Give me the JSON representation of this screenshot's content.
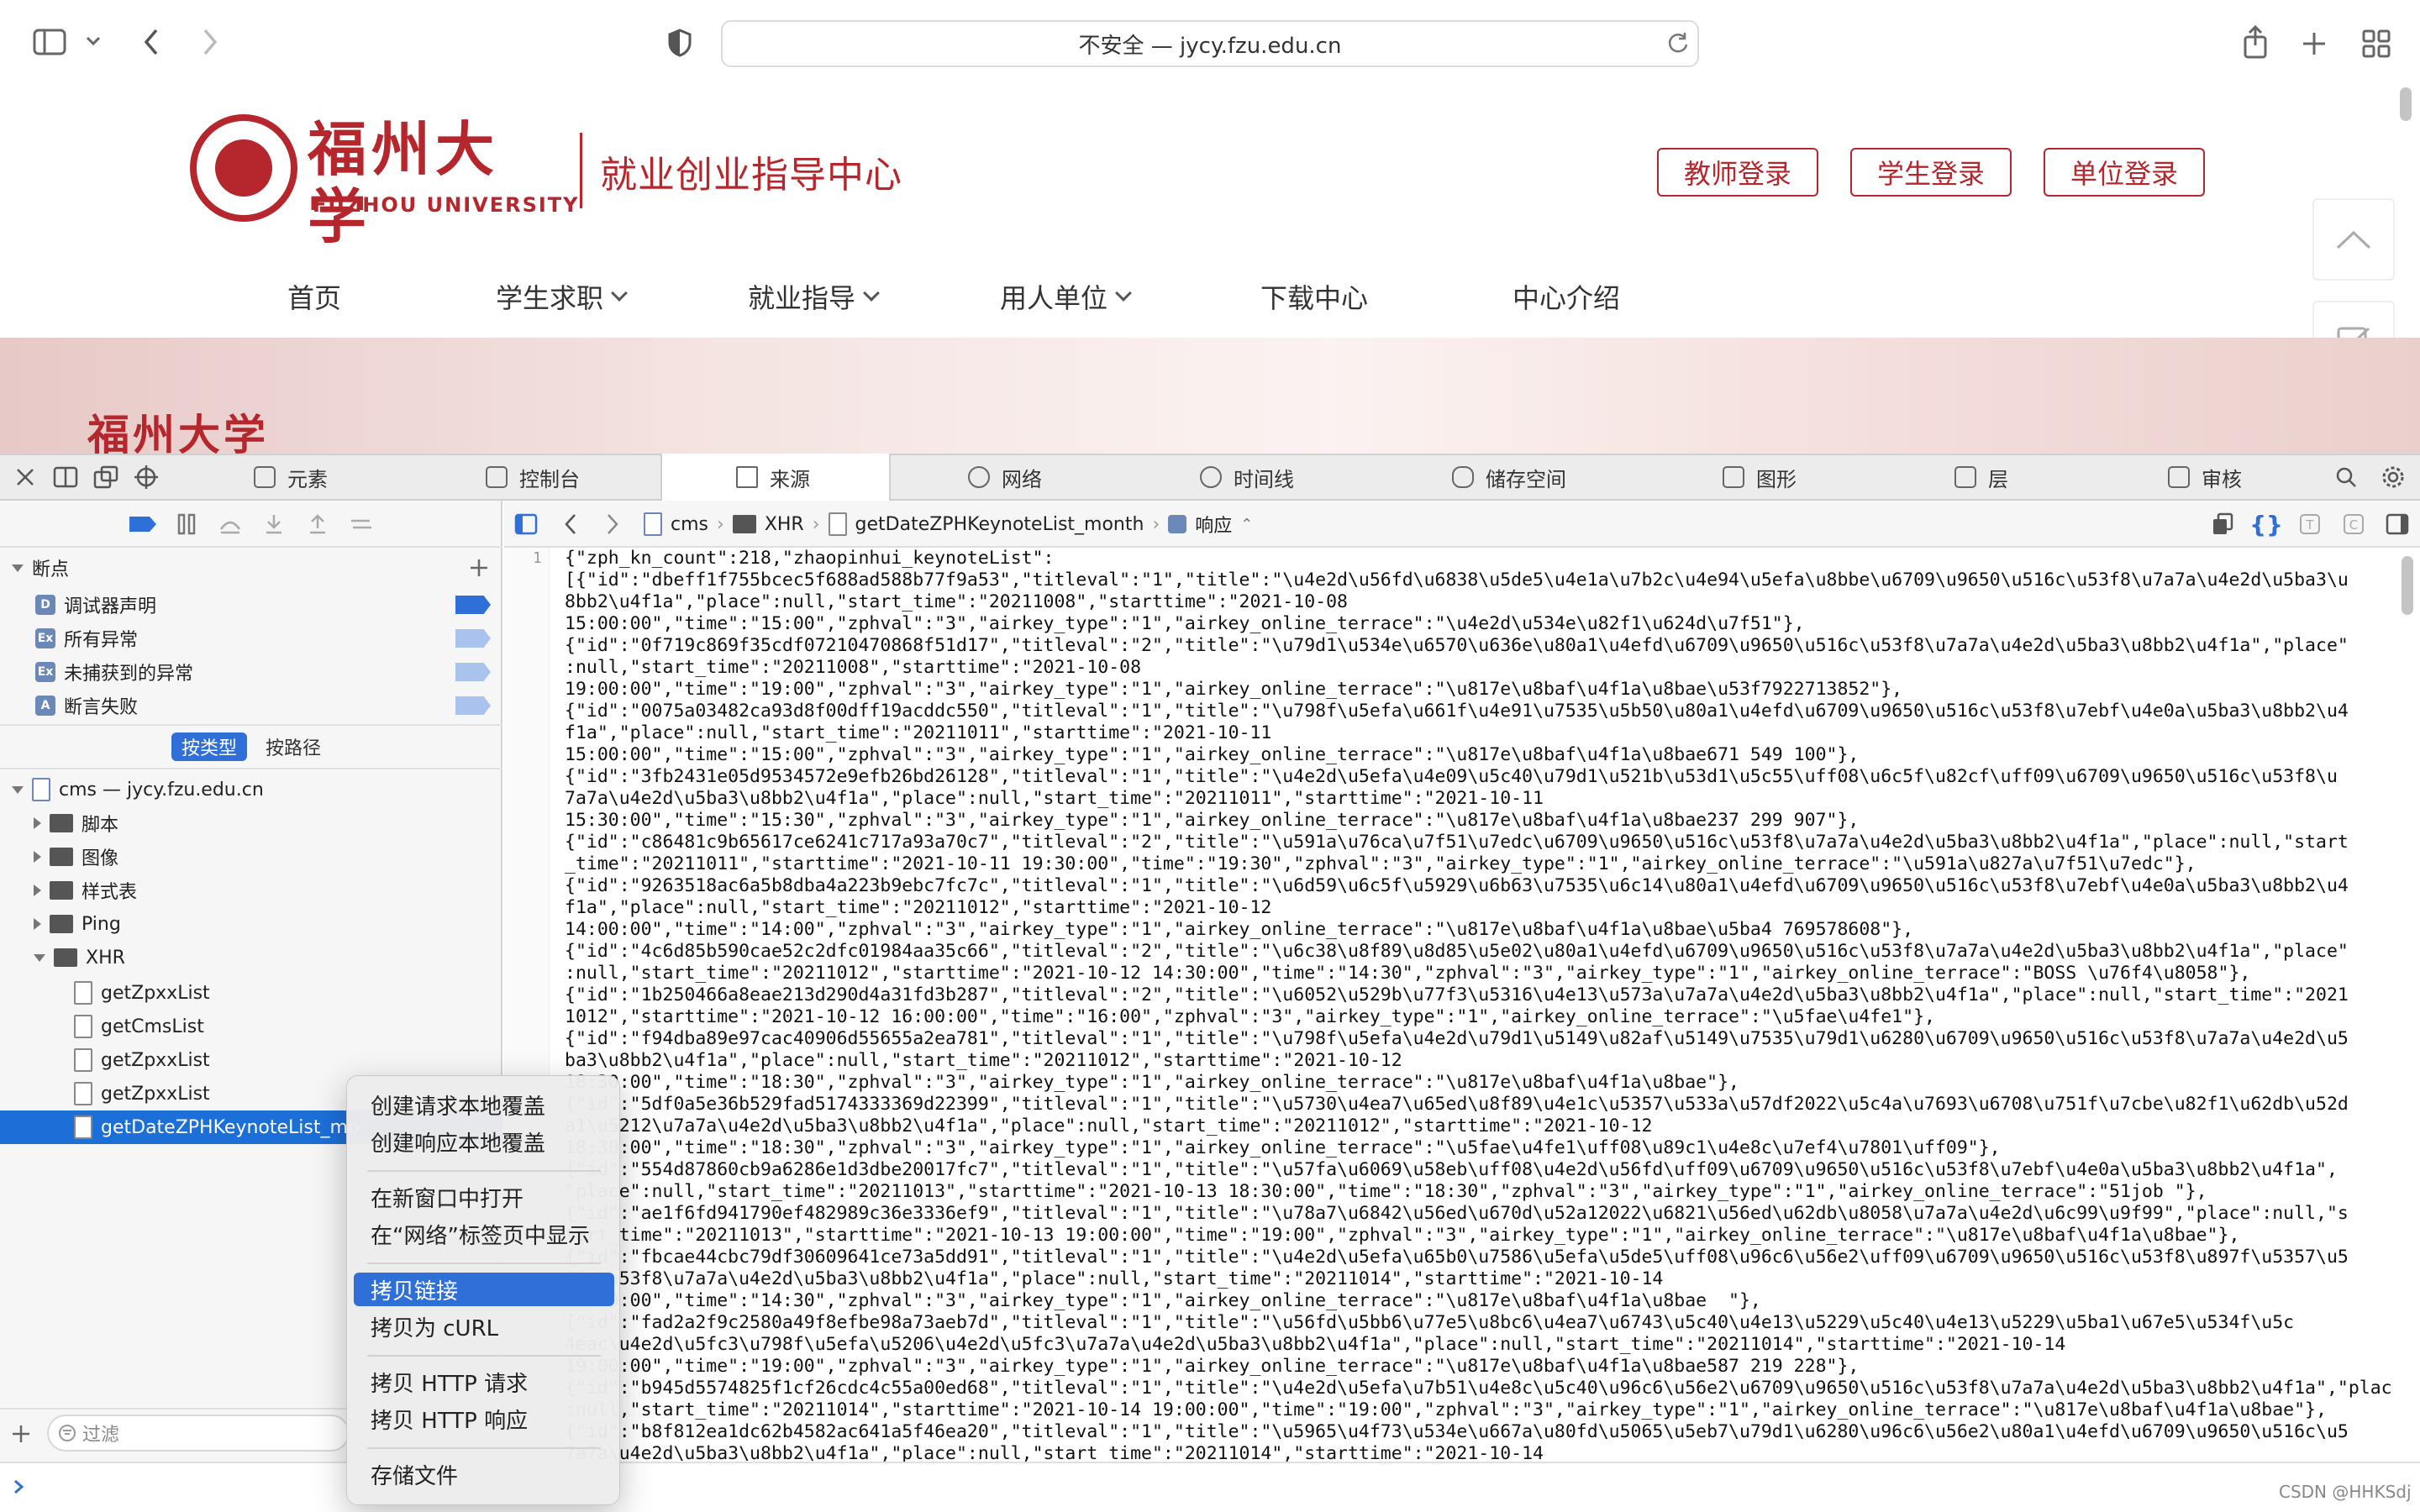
{
  "browser": {
    "address": "不安全 — jycy.fzu.edu.cn"
  },
  "site": {
    "logo_cn": "福州大学",
    "logo_en": "FUZHOU UNIVERSITY",
    "subtitle": "就业创业指导中心",
    "login_buttons": [
      "教师登录",
      "学生登录",
      "单位登录"
    ],
    "nav": [
      {
        "label": "首页",
        "has_dropdown": false
      },
      {
        "label": "学生求职",
        "has_dropdown": true
      },
      {
        "label": "就业指导",
        "has_dropdown": true
      },
      {
        "label": "用人单位",
        "has_dropdown": true
      },
      {
        "label": "下载中心",
        "has_dropdown": false
      },
      {
        "label": "中心介绍",
        "has_dropdown": false
      }
    ]
  },
  "devtools": {
    "tabs": [
      "元素",
      "控制台",
      "来源",
      "网络",
      "时间线",
      "储存空间",
      "图形",
      "层",
      "审核"
    ],
    "active_tab": "来源",
    "breakpoints": {
      "title": "断点",
      "items": [
        {
          "icon": "D",
          "label": "调试器声明",
          "color": "#2f6fd8"
        },
        {
          "icon": "Ex",
          "label": "所有异常",
          "color": "#a9c3ee"
        },
        {
          "icon": "Ex",
          "label": "未捕获到的异常",
          "color": "#a9c3ee"
        },
        {
          "icon": "A",
          "label": "断言失败",
          "color": "#a9c3ee"
        }
      ]
    },
    "group_buttons": [
      "按类型",
      "按路径"
    ],
    "tree": {
      "root": "cms — jycy.fzu.edu.cn",
      "folders": [
        "脚本",
        "图像",
        "样式表",
        "Ping",
        "XHR"
      ],
      "xhr_items": [
        "getZpxxList",
        "getCmsList",
        "getZpxxList",
        "getZpxxList",
        "getDateZPHKeynoteList_mo"
      ]
    },
    "filter_placeholder": "过滤",
    "breadcrumb": [
      "cms",
      "XHR",
      "getDateZPHKeynoteList_month",
      "响应"
    ],
    "line_number": "1",
    "code_lines": [
      "{\"zph_kn_count\":218,\"zhaopinhui_keynoteList\":",
      "[{\"id\":\"dbeff1f755bcec5f688ad588b77f9a53\",\"titleval\":\"1\",\"title\":\"\\u4e2d\\u56fd\\u6838\\u5de5\\u4e1a\\u7b2c\\u4e94\\u5efa\\u8bbe\\u6709\\u9650\\u516c\\u53f8\\u7a7a\\u4e2d\\u5ba3\\u",
      "8bb2\\u4f1a\",\"place\":null,\"start_time\":\"20211008\",\"starttime\":\"2021-10-08",
      "15:00:00\",\"time\":\"15:00\",\"zphval\":\"3\",\"airkey_type\":\"1\",\"airkey_online_terrace\":\"\\u4e2d\\u534e\\u82f1\\u624d\\u7f51\"},",
      "{\"id\":\"0f719c869f35cdf07210470868f51d17\",\"titleval\":\"2\",\"title\":\"\\u79d1\\u534e\\u6570\\u636e\\u80a1\\u4efd\\u6709\\u9650\\u516c\\u53f8\\u7a7a\\u4e2d\\u5ba3\\u8bb2\\u4f1a\",\"place\"",
      ":null,\"start_time\":\"20211008\",\"starttime\":\"2021-10-08",
      "19:00:00\",\"time\":\"19:00\",\"zphval\":\"3\",\"airkey_type\":\"1\",\"airkey_online_terrace\":\"\\u817e\\u8baf\\u4f1a\\u8bae\\u53f7922713852\"},",
      "{\"id\":\"0075a03482ca93d8f00dff19acddc550\",\"titleval\":\"1\",\"title\":\"\\u798f\\u5efa\\u661f\\u4e91\\u7535\\u5b50\\u80a1\\u4efd\\u6709\\u9650\\u516c\\u53f8\\u7ebf\\u4e0a\\u5ba3\\u8bb2\\u4",
      "f1a\",\"place\":null,\"start_time\":\"20211011\",\"starttime\":\"2021-10-11",
      "15:00:00\",\"time\":\"15:00\",\"zphval\":\"3\",\"airkey_type\":\"1\",\"airkey_online_terrace\":\"\\u817e\\u8baf\\u4f1a\\u8bae671 549 100\"},",
      "{\"id\":\"3fb2431e05d9534572e9efb26bd26128\",\"titleval\":\"1\",\"title\":\"\\u4e2d\\u5efa\\u4e09\\u5c40\\u79d1\\u521b\\u53d1\\u5c55\\uff08\\u6c5f\\u82cf\\uff09\\u6709\\u9650\\u516c\\u53f8\\u",
      "7a7a\\u4e2d\\u5ba3\\u8bb2\\u4f1a\",\"place\":null,\"start_time\":\"20211011\",\"starttime\":\"2021-10-11",
      "15:30:00\",\"time\":\"15:30\",\"zphval\":\"3\",\"airkey_type\":\"1\",\"airkey_online_terrace\":\"\\u817e\\u8baf\\u4f1a\\u8bae237 299 907\"},",
      "{\"id\":\"c86481c9b65617ce6241c717a93a70c7\",\"titleval\":\"2\",\"title\":\"\\u591a\\u76ca\\u7f51\\u7edc\\u6709\\u9650\\u516c\\u53f8\\u7a7a\\u4e2d\\u5ba3\\u8bb2\\u4f1a\",\"place\":null,\"start",
      "_time\":\"20211011\",\"starttime\":\"2021-10-11 19:30:00\",\"time\":\"19:30\",\"zphval\":\"3\",\"airkey_type\":\"1\",\"airkey_online_terrace\":\"\\u591a\\u827a\\u7f51\\u7edc\"},",
      "{\"id\":\"9263518ac6a5b8dba4a223b9ebc7fc7c\",\"titleval\":\"1\",\"title\":\"\\u6d59\\u6c5f\\u5929\\u6b63\\u7535\\u6c14\\u80a1\\u4efd\\u6709\\u9650\\u516c\\u53f8\\u7ebf\\u4e0a\\u5ba3\\u8bb2\\u4",
      "f1a\",\"place\":null,\"start_time\":\"20211012\",\"starttime\":\"2021-10-12",
      "14:00:00\",\"time\":\"14:00\",\"zphval\":\"3\",\"airkey_type\":\"1\",\"airkey_online_terrace\":\"\\u817e\\u8baf\\u4f1a\\u8bae\\u5ba4 769578608\"},",
      "{\"id\":\"4c6d85b590cae52c2dfc01984aa35c66\",\"titleval\":\"2\",\"title\":\"\\u6c38\\u8f89\\u8d85\\u5e02\\u80a1\\u4efd\\u6709\\u9650\\u516c\\u53f8\\u7a7a\\u4e2d\\u5ba3\\u8bb2\\u4f1a\",\"place\"",
      ":null,\"start_time\":\"20211012\",\"starttime\":\"2021-10-12 14:30:00\",\"time\":\"14:30\",\"zphval\":\"3\",\"airkey_type\":\"1\",\"airkey_online_terrace\":\"BOSS \\u76f4\\u8058\"},",
      "{\"id\":\"1b250466a8eae213d290d4a31fd3b287\",\"titleval\":\"2\",\"title\":\"\\u6052\\u529b\\u77f3\\u5316\\u4e13\\u573a\\u7a7a\\u4e2d\\u5ba3\\u8bb2\\u4f1a\",\"place\":null,\"start_time\":\"2021",
      "1012\",\"starttime\":\"2021-10-12 16:00:00\",\"time\":\"16:00\",\"zphval\":\"3\",\"airkey_type\":\"1\",\"airkey_online_terrace\":\"\\u5fae\\u4fe1\"},",
      "{\"id\":\"f94dba89e97cac40906d55655a2ea781\",\"titleval\":\"1\",\"title\":\"\\u798f\\u5efa\\u4e2d\\u79d1\\u5149\\u82af\\u5149\\u7535\\u79d1\\u6280\\u6709\\u9650\\u516c\\u53f8\\u7a7a\\u4e2d\\u5",
      "ba3\\u8bb2\\u4f1a\",\"place\":null,\"start_time\":\"20211012\",\"starttime\":\"2021-10-12",
      "18:30:00\",\"time\":\"18:30\",\"zphval\":\"3\",\"airkey_type\":\"1\",\"airkey_online_terrace\":\"\\u817e\\u8baf\\u4f1a\\u8bae\"},",
      "{\"id\":\"5df0a5e36b529fad5174333369d22399\",\"titleval\":\"1\",\"title\":\"\\u5730\\u4ea7\\u65ed\\u8f89\\u4e1c\\u5357\\u533a\\u57df2022\\u5c4a\\u7693\\u6708\\u751f\\u7cbe\\u82f1\\u62db\\u52d",
      "a1\\u5212\\u7a7a\\u4e2d\\u5ba3\\u8bb2\\u4f1a\",\"place\":null,\"start_time\":\"20211012\",\"starttime\":\"2021-10-12",
      "18:30:00\",\"time\":\"18:30\",\"zphval\":\"3\",\"airkey_type\":\"1\",\"airkey_online_terrace\":\"\\u5fae\\u4fe1\\uff08\\u89c1\\u4e8c\\u7ef4\\u7801\\uff09\"},",
      "{\"id\":\"554d87860cb9a6286e1d3dbe20017fc7\",\"titleval\":\"1\",\"title\":\"\\u57fa\\u6069\\u58eb\\uff08\\u4e2d\\u56fd\\uff09\\u6709\\u9650\\u516c\\u53f8\\u7ebf\\u4e0a\\u5ba3\\u8bb2\\u4f1a\",",
      "\"place\":null,\"start_time\":\"20211013\",\"starttime\":\"2021-10-13 18:30:00\",\"time\":\"18:30\",\"zphval\":\"3\",\"airkey_type\":\"1\",\"airkey_online_terrace\":\"51job \"},",
      "{\"id\":\"ae1f6fd941790ef482989c36e3336ef9\",\"titleval\":\"1\",\"title\":\"\\u78a7\\u6842\\u56ed\\u670d\\u52a12022\\u6821\\u56ed\\u62db\\u8058\\u7a7a\\u4e2d\\u6c99\\u9f99\",\"place\":null,\"s",
      "tart_time\":\"20211013\",\"starttime\":\"2021-10-13 19:00:00\",\"time\":\"19:00\",\"zphval\":\"3\",\"airkey_type\":\"1\",\"airkey_online_terrace\":\"\\u817e\\u8baf\\u4f1a\\u8bae\"},",
      "{\"id\":\"fbcae44cbc79df30609641ce73a5dd91\",\"titleval\":\"1\",\"title\":\"\\u4e2d\\u5efa\\u65b0\\u7586\\u5efa\\u5de5\\uff08\\u96c6\\u56e2\\uff09\\u6709\\u9650\\u516c\\u53f8\\u897f\\u5357\\u5",
      "16c\\u53f8\\u7a7a\\u4e2d\\u5ba3\\u8bb2\\u4f1a\",\"place\":null,\"start_time\":\"20211014\",\"starttime\":\"2021-10-14",
      "14:30:00\",\"time\":\"14:30\",\"zphval\":\"3\",\"airkey_type\":\"1\",\"airkey_online_terrace\":\"\\u817e\\u8baf\\u4f1a\\u8bae  \"},",
      "{\"id\":\"fad2a2f9c2580a49f8efbe98a73aeb7d\",\"titleval\":\"1\",\"title\":\"\\u56fd\\u5bb6\\u77e5\\u8bc6\\u4ea7\\u6743\\u5c40\\u4e13\\u5229\\u5c40\\u4e13\\u5229\\u5ba1\\u67e5\\u534f\\u5c",
      "4eac\\u4e2d\\u5fc3\\u798f\\u5efa\\u5206\\u4e2d\\u5fc3\\u7a7a\\u4e2d\\u5ba3\\u8bb2\\u4f1a\",\"place\":null,\"start_time\":\"20211014\",\"starttime\":\"2021-10-14",
      "19:00:00\",\"time\":\"19:00\",\"zphval\":\"3\",\"airkey_type\":\"1\",\"airkey_online_terrace\":\"\\u817e\\u8baf\\u4f1a\\u8bae587 219 228\"},",
      "{\"id\":\"b945d5574825f1cf26cdc4c55a00ed68\",\"titleval\":\"1\",\"title\":\"\\u4e2d\\u5efa\\u7b51\\u4e8c\\u5c40\\u96c6\\u56e2\\u6709\\u9650\\u516c\\u53f8\\u7a7a\\u4e2d\\u5ba3\\u8bb2\\u4f1a\",\"place\"",
      ":null,\"start_time\":\"20211014\",\"starttime\":\"2021-10-14 19:00:00\",\"time\":\"19:00\",\"zphval\":\"3\",\"airkey_type\":\"1\",\"airkey_online_terrace\":\"\\u817e\\u8baf\\u4f1a\\u8bae\"},",
      "{\"id\":\"b8f812ea1dc62b4582ac641a5f46ea20\",\"titleval\":\"1\",\"title\":\"\\u5965\\u4f73\\u534e\\u667a\\u80fd\\u5065\\u5eb7\\u79d1\\u6280\\u96c6\\u56e2\\u80a1\\u4efd\\u6709\\u9650\\u516c\\u5",
      "7a7a\\u4e2d\\u5ba3\\u8bb2\\u4f1a\",\"place\":null,\"start_time\":\"20211014\",\"starttime\":\"2021-10-14"
    ],
    "context_menu": {
      "items": [
        [
          "创建请求本地覆盖",
          "创建响应本地覆盖"
        ],
        [
          "在新窗口中打开",
          "在“网络”标签页中显示"
        ],
        [
          "拷贝链接",
          "拷贝为 cURL"
        ],
        [
          "拷贝 HTTP 请求",
          "拷贝 HTTP 响应"
        ],
        [
          "存储文件"
        ]
      ],
      "highlighted": "拷贝链接"
    }
  },
  "watermark": "CSDN @HHKSdj",
  "colors": {
    "brand_red": "#b5272d",
    "selection_blue": "#1d6fd8",
    "highlight_blue": "#2f6fd8"
  }
}
